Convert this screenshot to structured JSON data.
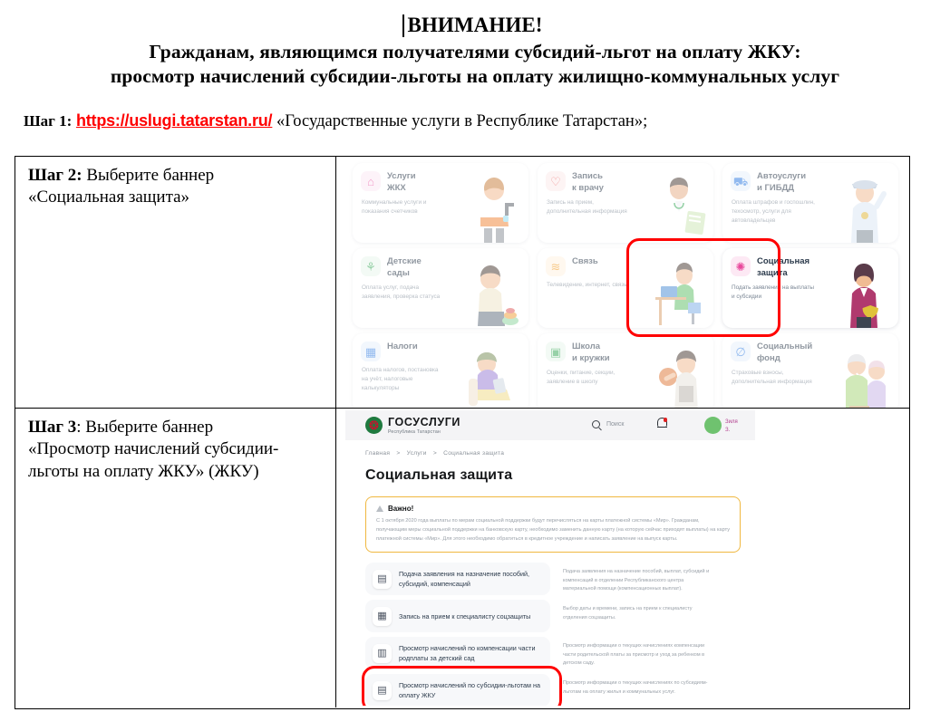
{
  "document": {
    "heading_attention": "ВНИМАНИЕ!",
    "heading_line2": "Гражданам, являющимся получателями субсидий-льгот на оплату ЖКУ:",
    "heading_line3": "просмотр начислений субсидии-льготы на оплату жилищно-коммунальных услуг",
    "step1": {
      "label": "Шаг 1:",
      "url": "https://uslugi.tatarstan.ru/",
      "tail": "«Государственные услуги в Республике Татарстан»;",
      "url_color": "#ff0000"
    },
    "step2": {
      "label": "Шаг 2:",
      "text": " Выберите баннер",
      "text_line2": "«Социальная защита»"
    },
    "step3": {
      "label": "Шаг 3",
      "text": ": Выберите баннер",
      "text_line2": "«Просмотр начислений субсидии-",
      "text_line3": "льготы на оплату ЖКУ» (ЖКУ)"
    }
  },
  "screenshot_step2": {
    "highlight_color": "#ff0000",
    "cards": [
      {
        "title": "Услуги\nЖКХ",
        "title_l1": "Услуги",
        "title_l2": "ЖКХ",
        "desc": "Коммунальные услуги и показания счетчиков",
        "icon": "house-icon",
        "icon_glyph": "⌂",
        "icon_bg": "#fde9f4",
        "icon_color": "#e8479b",
        "highlighted": false
      },
      {
        "title_l1": "Запись",
        "title_l2": "к врачу",
        "desc": "Запись на прием, дополнительная информация",
        "icon": "stethoscope-icon",
        "icon_glyph": "♡",
        "icon_bg": "#fdeaea",
        "icon_color": "#e23b3b",
        "highlighted": false
      },
      {
        "title_l1": "Автоуслуги",
        "title_l2": "и ГИБДД",
        "desc": "Оплата штрафов и госпошлин, техосмотр, услуги для автовладельцев",
        "icon": "car-icon",
        "icon_glyph": "⛟",
        "icon_bg": "#e8f0fd",
        "icon_color": "#2f7de1",
        "highlighted": false
      },
      {
        "title_l1": "Детские",
        "title_l2": "сады",
        "desc": "Оплата услуг, подача заявления, проверка статуса",
        "icon": "rocking-horse-icon",
        "icon_glyph": "⚘",
        "icon_bg": "#e9f7ec",
        "icon_color": "#3aa85a",
        "highlighted": false
      },
      {
        "title_l1": "Связь",
        "title_l2": "",
        "desc": "Телевидение, интернет, связь",
        "icon": "wifi-icon",
        "icon_glyph": "≋",
        "icon_bg": "#fff3e2",
        "icon_color": "#f0991f",
        "highlighted": false
      },
      {
        "title_l1": "Социальная",
        "title_l2": "защита",
        "desc": "Подать заявления на выплаты и субсидии",
        "icon": "social-protection-icon",
        "icon_glyph": "✺",
        "icon_bg": "#fde9f4",
        "icon_color": "#e8479b",
        "highlighted": true
      },
      {
        "title_l1": "Налоги",
        "title_l2": "",
        "desc": "Оплата налогов, постановка на учёт, налоговые калькуляторы",
        "icon": "calculator-icon",
        "icon_glyph": "▦",
        "icon_bg": "#e8f0fd",
        "icon_color": "#2f7de1",
        "highlighted": false
      },
      {
        "title_l1": "Школа",
        "title_l2": "и кружки",
        "desc": "Оценки, питание, секции, заявление в школу",
        "icon": "backpack-icon",
        "icon_glyph": "▣",
        "icon_bg": "#e9f7ec",
        "icon_color": "#3aa85a",
        "highlighted": false
      },
      {
        "title_l1": "Социальный",
        "title_l2": "фонд",
        "desc": "Страховые взносы, дополнительная информация",
        "icon": "social-fund-icon",
        "icon_glyph": "∅",
        "icon_bg": "#e8f0fd",
        "icon_color": "#2f7de1",
        "highlighted": false
      }
    ]
  },
  "screenshot_step3": {
    "highlight_color": "#ff0000",
    "header": {
      "logo_main": "ГОСУСЛУГИ",
      "logo_sub": "Республика Татарстан",
      "search_placeholder": "Поиск",
      "user_name_l1": "Зиля",
      "user_name_l2": "З."
    },
    "breadcrumbs": [
      "Главная",
      "Услуги",
      "Социальная защита"
    ],
    "breadcrumb_sep": ">",
    "page_title": "Социальная защита",
    "notice": {
      "title": "Важно!",
      "text": "С 1 октября 2020 года выплаты по мерам социальной поддержки будут перечисляться на карты платежной системы «Мир». Гражданам, получающим меры социальной поддержки на банковскую карту, необходимо заменить данную карту (на которую сейчас приходят выплаты) на карту платежной системы «Мир». Для этого необходимо обратиться в кредитное учреждение и написать заявление на выпуск карты.",
      "border_color": "#f0b840"
    },
    "services": [
      {
        "title": "Подача заявления на назначение пособий, субсидий, компенсаций",
        "desc": "Подача заявления на назначение пособий, выплат, субсидий и компенсаций в отделении Республиканского центра материальной помощи (компенсационных выплат).",
        "icon": "document-gear-icon",
        "icon_glyph": "🗎",
        "highlighted": false
      },
      {
        "title": "Запись на прием к специалисту соцзащиты",
        "desc": "Выбор даты и времени, запись на прием к специалисту отделения соцзащиты.",
        "icon": "calendar-icon",
        "icon_glyph": "▤",
        "highlighted": false
      },
      {
        "title": "Просмотр начислений по компенсации части родплаты за детский сад",
        "desc": "Просмотр информации о текущих начислениях компенсации части родительской платы за присмотр и уход за ребенком в детском саду.",
        "icon": "receipt-search-icon",
        "icon_glyph": "▥",
        "highlighted": false
      },
      {
        "title": "Просмотр начислений по субсидии-льготам на оплату ЖКУ",
        "desc": "Просмотр информации о текущих начислениях по субсидиям-льготам на оплату жилья и коммунальных услуг.",
        "icon": "bill-search-icon",
        "icon_glyph": "▤",
        "highlighted": true
      }
    ]
  }
}
